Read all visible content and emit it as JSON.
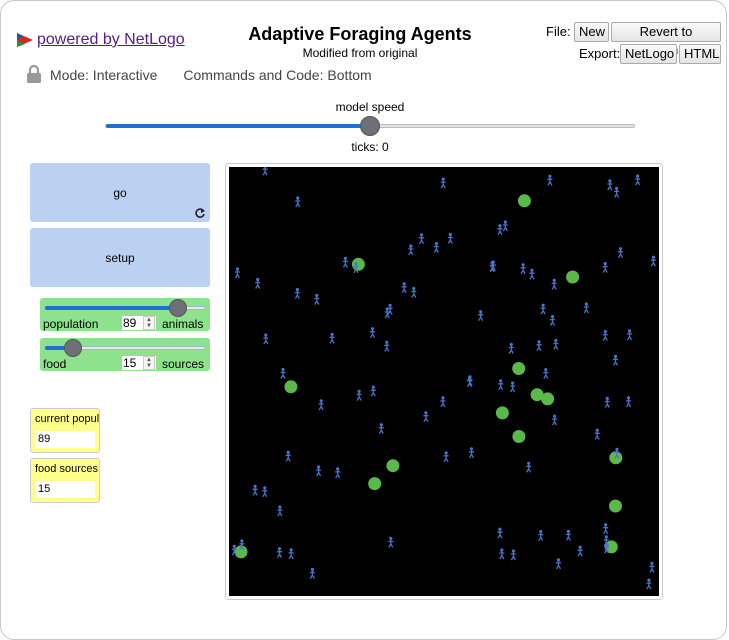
{
  "header": {
    "powered_by": "powered by NetLogo",
    "title": "Adaptive Foraging Agents",
    "subtitle": "Modified from original",
    "file_label": "File:",
    "export_label": "Export:",
    "new_button": "New",
    "revert_button": "Revert to Original",
    "export_netlogo": "NetLogo",
    "export_html": "HTML"
  },
  "mode_bar": {
    "mode": "Mode: Interactive",
    "commands": "Commands and Code: Bottom"
  },
  "speed": {
    "label": "model speed",
    "ticks": "ticks: 0",
    "value": 0.5
  },
  "buttons": {
    "go": "go",
    "setup": "setup"
  },
  "sliders": {
    "population": {
      "name": "population",
      "value": "89",
      "units": "animals",
      "fraction": 0.83
    },
    "food": {
      "name": "food",
      "value": "15",
      "units": "sources",
      "fraction": 0.18
    }
  },
  "monitors": {
    "current_population": {
      "name": "current popul",
      "value": "89"
    },
    "food_sources": {
      "name": "food sources",
      "value": "15"
    }
  },
  "world": {
    "background": "#000000",
    "agent_color": "#4a74c9",
    "food_color": "#5bb84a"
  }
}
